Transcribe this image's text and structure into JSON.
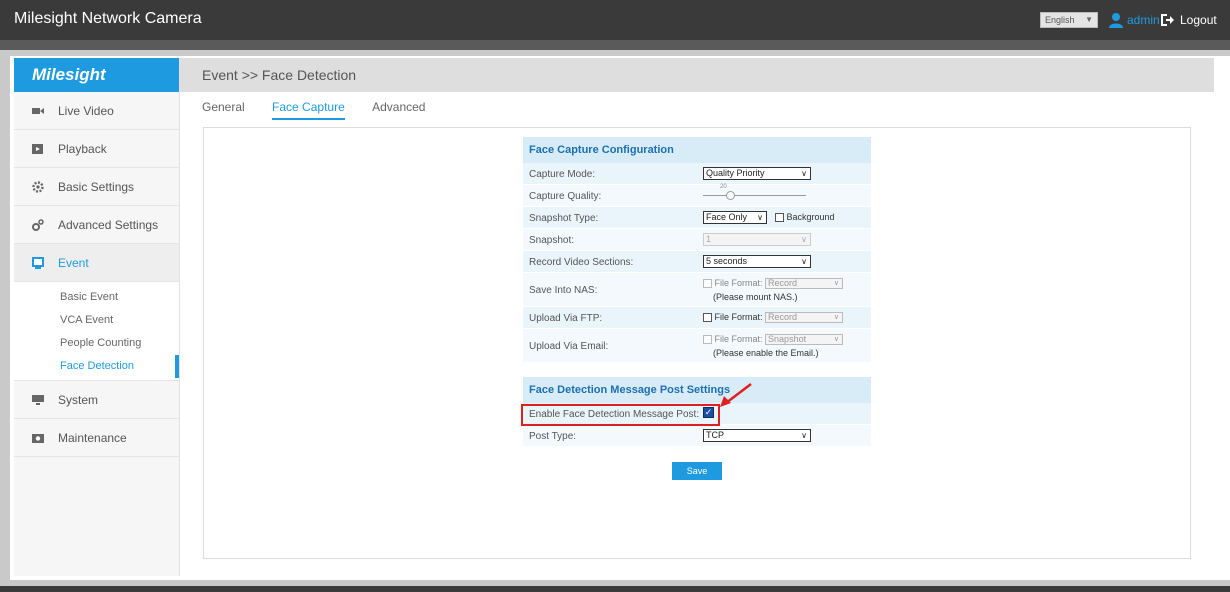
{
  "header": {
    "title": "Milesight Network Camera",
    "language": "English",
    "user": "admin",
    "logout": "Logout"
  },
  "sidebar": {
    "brand": "Milesight",
    "items": [
      {
        "label": "Live Video",
        "icon": "video-camera-icon"
      },
      {
        "label": "Playback",
        "icon": "play-icon"
      },
      {
        "label": "Basic Settings",
        "icon": "gear-icon"
      },
      {
        "label": "Advanced Settings",
        "icon": "gears-icon"
      },
      {
        "label": "Event",
        "icon": "event-icon"
      },
      {
        "label": "System",
        "icon": "monitor-icon"
      },
      {
        "label": "Maintenance",
        "icon": "camera-icon"
      }
    ],
    "event_sub": [
      "Basic Event",
      "VCA Event",
      "People Counting",
      "Face Detection"
    ]
  },
  "breadcrumb": "Event >> Face Detection",
  "tabs": [
    "General",
    "Face Capture",
    "Advanced"
  ],
  "form": {
    "section1": "Face Capture Configuration",
    "capture_mode_label": "Capture Mode:",
    "capture_mode_value": "Quality Priority",
    "capture_quality_label": "Capture Quality:",
    "capture_quality_value": "20",
    "snapshot_type_label": "Snapshot Type:",
    "snapshot_type_value": "Face Only",
    "background_label": "Background",
    "snapshot_label": "Snapshot:",
    "snapshot_value": "1",
    "record_label": "Record Video Sections:",
    "record_value": "5 seconds",
    "nas_label": "Save Into NAS:",
    "file_format": "File Format:",
    "nas_format": "Record",
    "nas_note": "(Please mount NAS.)",
    "ftp_label": "Upload Via FTP:",
    "ftp_format": "Record",
    "email_label": "Upload Via Email:",
    "email_format": "Snapshot",
    "email_note": "(Please enable the Email.)",
    "section2": "Face Detection Message Post Settings",
    "enable_label": "Enable Face Detection Message Post:",
    "post_type_label": "Post Type:",
    "post_type_value": "TCP",
    "save": "Save"
  },
  "colors": {
    "accent": "#1e9be0",
    "highlight": "#e02020"
  }
}
